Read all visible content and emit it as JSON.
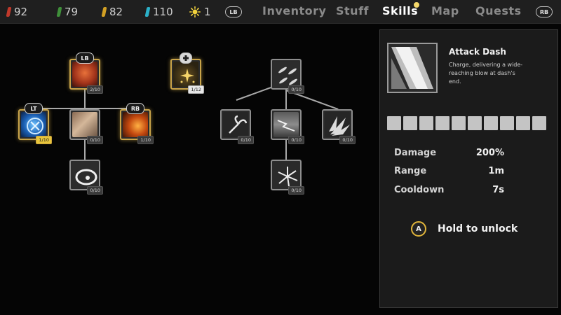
{
  "resources": [
    {
      "icon": "red-crystal-icon",
      "color": "#c0392b",
      "value": "92"
    },
    {
      "icon": "green-crystal-icon",
      "color": "#3f8f3a",
      "value": "79"
    },
    {
      "icon": "gold-crystal-icon",
      "color": "#d2a024",
      "value": "82"
    },
    {
      "icon": "cyan-crystal-icon",
      "color": "#2bb0c8",
      "value": "110"
    },
    {
      "icon": "sun-icon",
      "color": "#f2d23c",
      "value": "1"
    }
  ],
  "nav": {
    "left_bumper": "LB",
    "right_bumper": "RB",
    "tabs": [
      "Inventory",
      "Stuff",
      "Skills",
      "Map",
      "Quests"
    ],
    "active_tab": "Skills"
  },
  "tree": {
    "nodes": {
      "fire_root": {
        "level": "2/10",
        "badge": "LB"
      },
      "lightning": {
        "level": "1/10",
        "badge": "LT"
      },
      "slash": {
        "level": "0/10"
      },
      "meteor": {
        "level": "1/10",
        "badge": "RB"
      },
      "spin": {
        "level": "0/10"
      },
      "holy": {
        "level": "1/12"
      },
      "claws_root": {
        "level": "0/10"
      },
      "whirl": {
        "level": "0/10"
      },
      "storm": {
        "level": "0/10"
      },
      "attack_dash": {
        "level": "0/10"
      },
      "shatter": {
        "level": "0/10"
      }
    }
  },
  "panel": {
    "title": "Attack Dash",
    "description": "Charge, delivering a wide-reaching blow at dash's end.",
    "slots_total": 10,
    "stats": [
      {
        "label": "Damage",
        "value": "200%"
      },
      {
        "label": "Range",
        "value": "1m"
      },
      {
        "label": "Cooldown",
        "value": "7s"
      }
    ],
    "action_button": "A",
    "action_label": "Hold to unlock"
  },
  "colors": {
    "accent_gold": "#e0b43a",
    "active_tab": "#ffffff",
    "inactive_tab": "#8a8a8a"
  }
}
